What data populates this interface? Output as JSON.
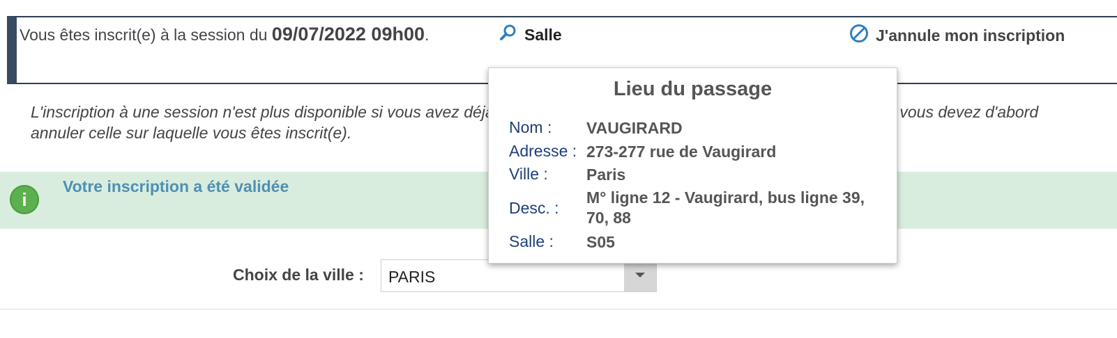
{
  "session": {
    "prefix": "Vous êtes inscrit(e) à la session du ",
    "date": "09/07/2022 09h00",
    "suffix": ".",
    "salle_link": "Salle",
    "cancel_label": "J'annule mon inscription"
  },
  "note": "L'inscription à une session n'est plus disponible si vous avez déjà une inscription en cours. Pour vous inscrire à une autre, vous devez d'abord annuler celle sur laquelle vous êtes inscrit(e).",
  "success": {
    "message": "Votre inscription a été validée",
    "icon": "info-icon"
  },
  "city": {
    "label": "Choix de la ville :",
    "selected": "PARIS"
  },
  "popup": {
    "title": "Lieu du passage",
    "rows": [
      {
        "label": "Nom :",
        "value": "VAUGIRARD"
      },
      {
        "label": "Adresse :",
        "value": "273-277 rue de Vaugirard"
      },
      {
        "label": "Ville :",
        "value": "Paris"
      },
      {
        "label": "Desc. :",
        "value": "M° ligne 12 - Vaugirard, bus ligne 39, 70, 88"
      },
      {
        "label": "Salle :",
        "value": "S05"
      }
    ]
  },
  "colors": {
    "accent_bar": "#3a4b61",
    "success_bg": "#d9eddf",
    "success_text": "#4f8fb3",
    "success_icon": "#5db04f",
    "popup_label": "#1f3f7a"
  }
}
